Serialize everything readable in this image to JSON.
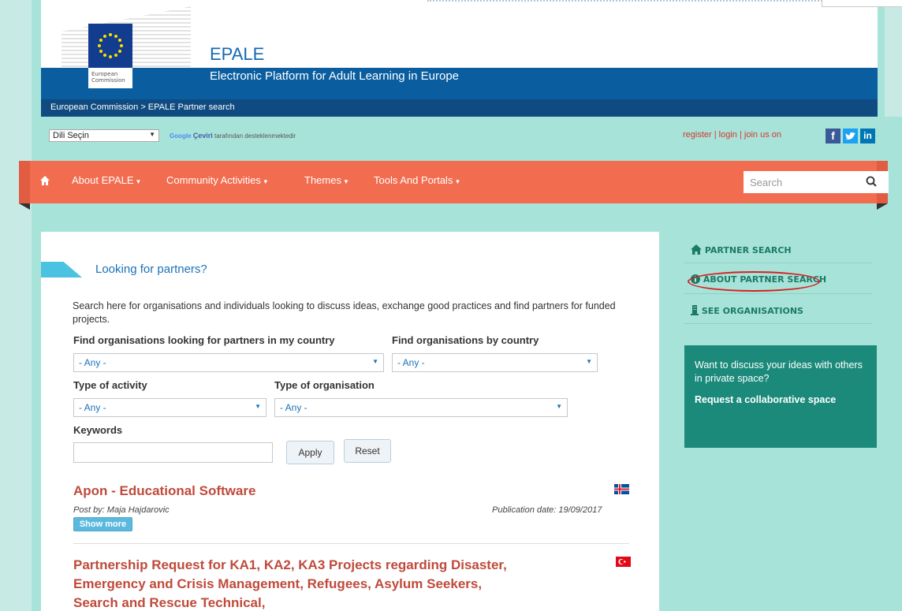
{
  "header": {
    "ec_label_line1": "European",
    "ec_label_line2": "Commission",
    "site_title": "EPALE",
    "site_subtitle": "Electronic Platform for Adult Learning in Europe",
    "breadcrumb": "European Commission > EPALE Partner search"
  },
  "translate": {
    "language_value": "Dili Seçin",
    "google_word": "Google",
    "ceviri": "Çeviri",
    "credit_rest": "tarafından desteklenmektedir"
  },
  "account": {
    "register": "register",
    "login": "login",
    "join": "join us on",
    "sep": "|"
  },
  "social": {
    "facebook": "f",
    "linkedin": "in"
  },
  "nav": {
    "items": [
      {
        "label": "About EPALE"
      },
      {
        "label": "Community Activities"
      },
      {
        "label": "Themes"
      },
      {
        "label": "Tools And Portals"
      }
    ],
    "search_placeholder": "Search"
  },
  "main": {
    "heading": "Looking for partners?",
    "intro": "Search here for organisations and individuals looking to discuss ideas, exchange good practices and find partners for funded projects.",
    "filters": {
      "my_country_label": "Find organisations looking for partners in my country",
      "my_country_value": "- Any -",
      "by_country_label": "Find organisations by country",
      "by_country_value": "- Any -",
      "activity_label": "Type of activity",
      "activity_value": "- Any -",
      "org_type_label": "Type of organisation",
      "org_type_value": "- Any -",
      "keywords_label": "Keywords",
      "keywords_value": "",
      "apply": "Apply",
      "reset": "Reset"
    },
    "results": [
      {
        "title": "Apon - Educational Software",
        "post_by": "Post by: Maja Hajdarovic",
        "publication_date": "Publication date: 19/09/2017",
        "show_more": "Show more",
        "flag": "iceland-flag-icon"
      },
      {
        "title_line1": "Partnership Request for KA1, KA2, KA3 Projects regarding Disaster,",
        "title_line2": "Emergency and Crisis Management, Refugees, Asylum Seekers,",
        "title_line3": "Search and Rescue Technical,",
        "flag": "turkey-flag-icon"
      }
    ]
  },
  "sidebar": {
    "links": [
      {
        "label": "PARTNER SEARCH",
        "icon": "home-icon"
      },
      {
        "label": "ABOUT PARTNER SEARCH",
        "icon": "info-icon"
      },
      {
        "label": "SEE ORGANISATIONS",
        "icon": "building-icon"
      }
    ],
    "promo_text": "Want to discuss your ideas with others in private space?",
    "promo_link": "Request a collaborative space"
  },
  "colors": {
    "nav_bg": "#f26c4f",
    "ec_blue": "#0a5ea0",
    "page_bg": "#a8e3d9",
    "result_title": "#bf4a3b",
    "promo_bg": "#1b8a7a",
    "highlight_ellipse": "#d62020"
  }
}
